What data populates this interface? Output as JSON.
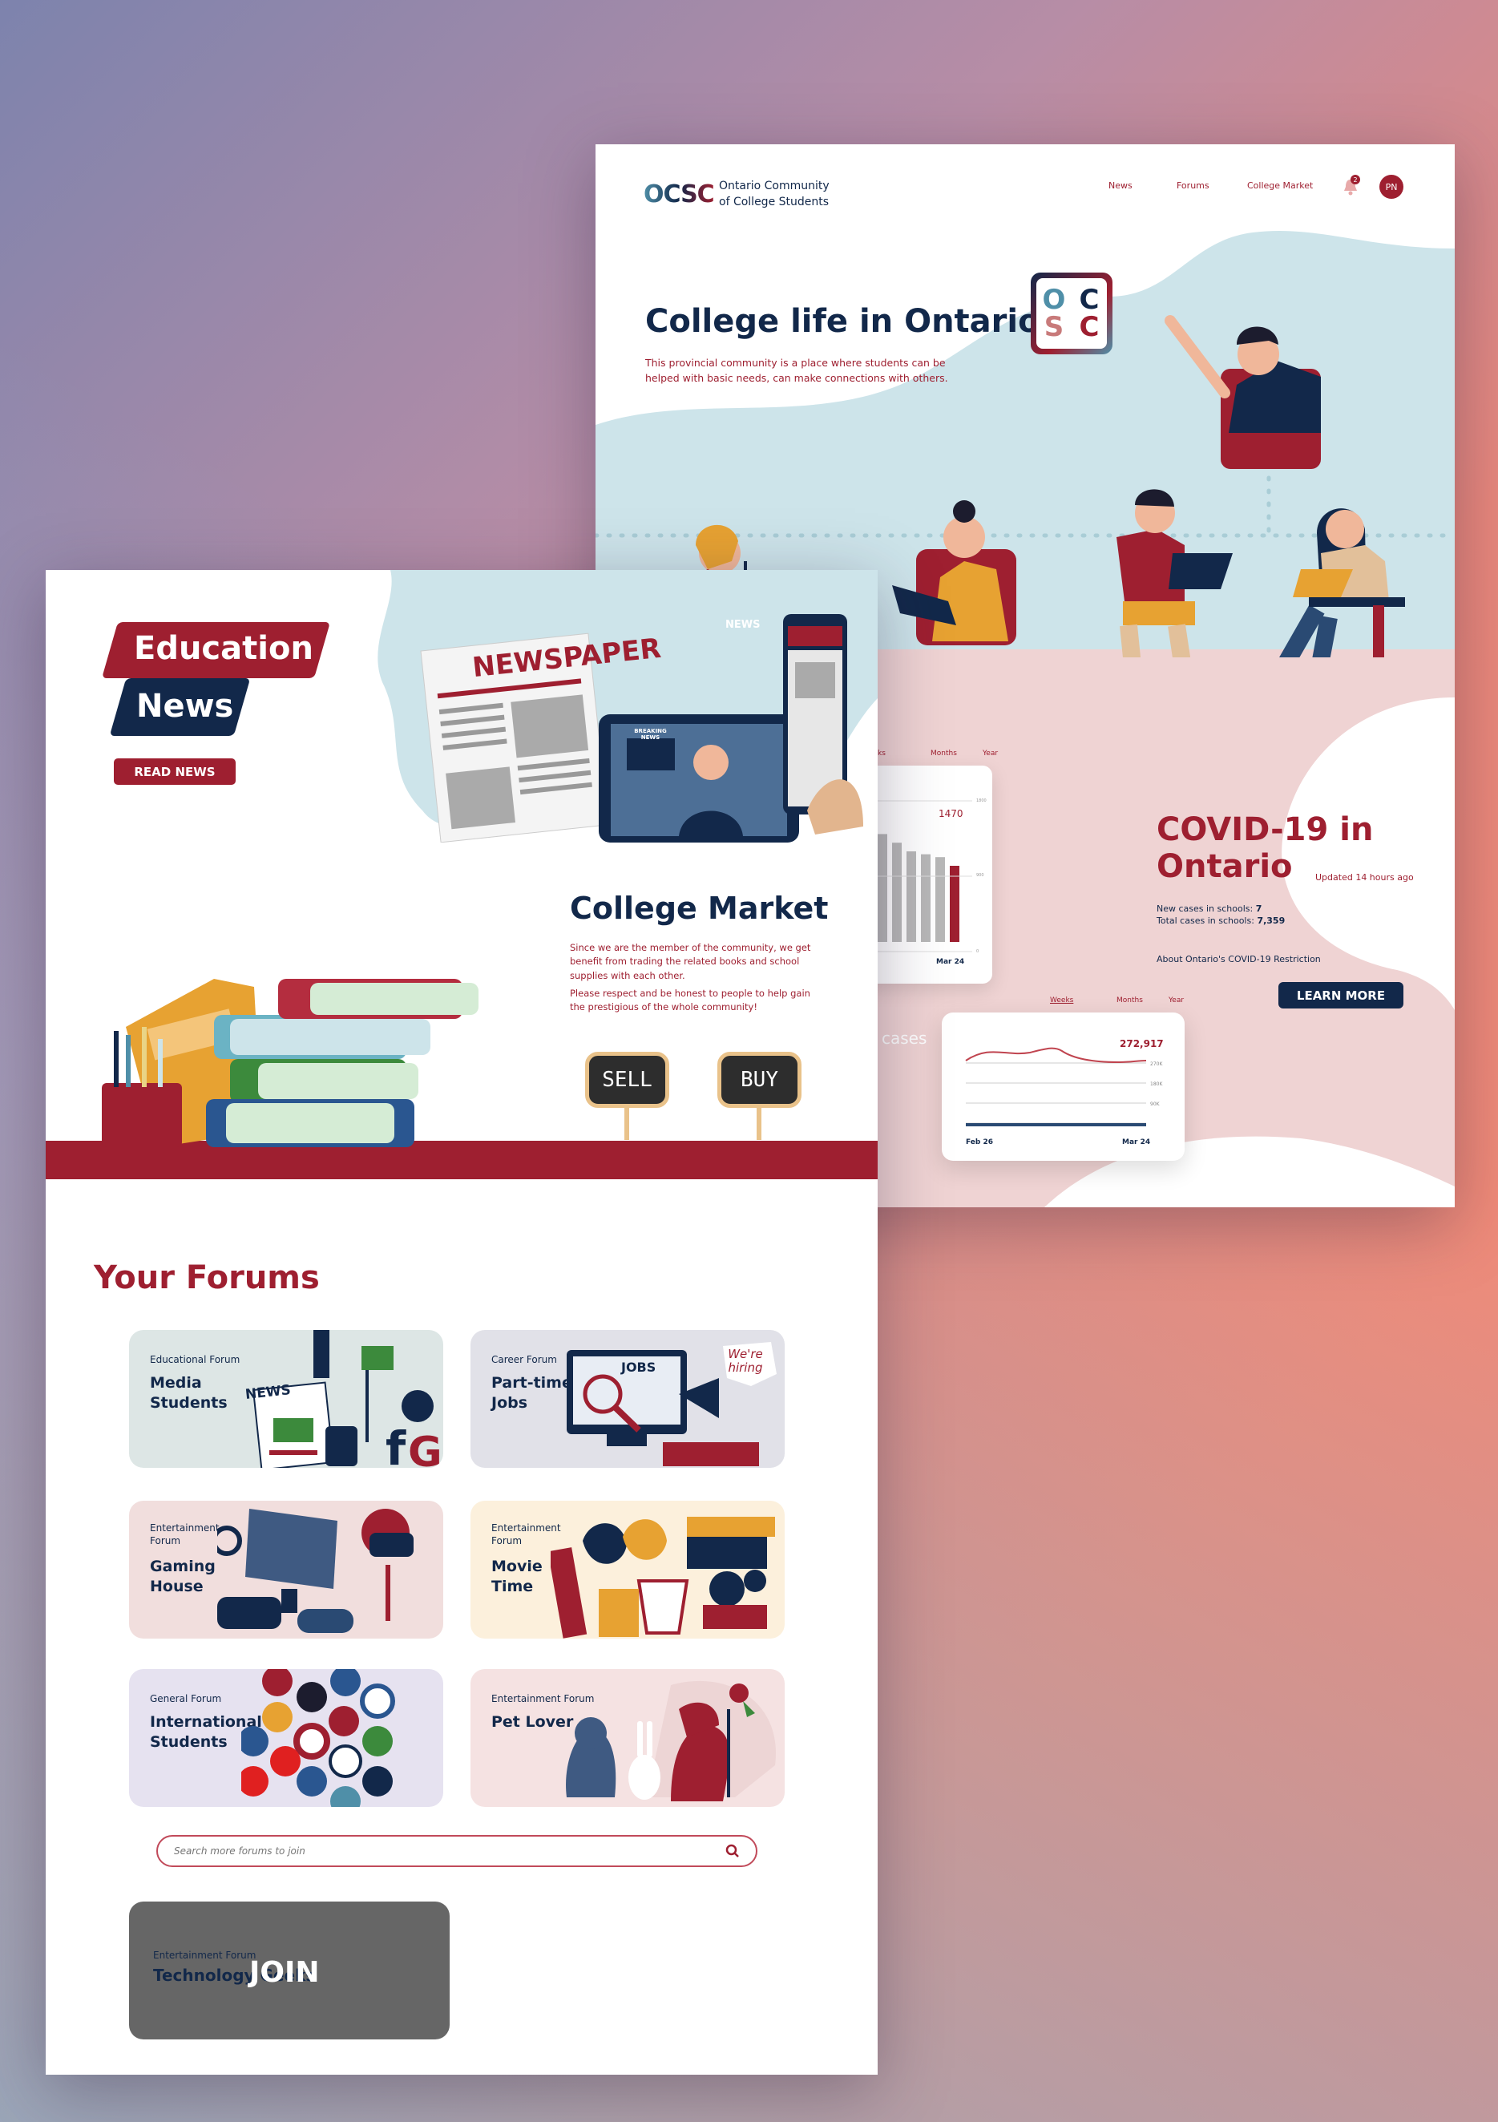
{
  "site": {
    "logo_text": "OCSC",
    "name_line1": "Ontario Community",
    "name_line2": "of College Students"
  },
  "nav": {
    "items": [
      "News",
      "Forums",
      "College Market"
    ],
    "notification_count": "2",
    "avatar_initials": "PN"
  },
  "hero": {
    "title": "College life in Ontario",
    "subtitle": "This provincial community is a place where students can be helped with basic needs, can make connections with others."
  },
  "covid": {
    "title_line1": "COVID-19 in",
    "title_line2": "Ontario",
    "updated": "Updated 14 hours ago",
    "new_cases_label": "New cases in schools: ",
    "new_cases_value": "7",
    "total_cases_label": "Total cases in schools: ",
    "total_cases_value": "7,359",
    "restriction_link": "About Ontario's COVID-19 Restriction",
    "learn_more": "LEARN MORE",
    "cases_word": "cases",
    "tabs_top": [
      "ks",
      "Months",
      "Year"
    ],
    "tabs_bottom": [
      "Weeks",
      "Months",
      "Year"
    ],
    "bar_label": "1470",
    "bar_axis": [
      "1800",
      "900",
      "0"
    ],
    "bar_date": "Mar 24",
    "line_label": "272,917",
    "line_axis": [
      "270K",
      "180K",
      "90K"
    ],
    "line_date_start": "Feb 26",
    "line_date_end": "Mar 24"
  },
  "education": {
    "title_line1": "Education",
    "title_line2": "News",
    "read_news": "READ NEWS",
    "newspaper": "NEWSPAPER",
    "phone_news": "NEWS",
    "breaking": "BREAKING NEWS"
  },
  "market": {
    "title": "College Market",
    "para1": "Since we are the member of the community, we get benefit from trading the related books and school supplies with each other.",
    "para2": "Please respect and be honest to people to help gain the prestigious of the whole community!",
    "sell": "SELL",
    "buy": "BUY"
  },
  "forums": {
    "title": "Your Forums",
    "items": [
      {
        "category": "Educational Forum",
        "name": "Media\nStudents"
      },
      {
        "category": "Career Forum",
        "name": "Part-time\nJobs"
      },
      {
        "category": "Entertainment\nForum",
        "name": "Gaming\nHouse"
      },
      {
        "category": "Entertainment\nForum",
        "name": "Movie\nTime"
      },
      {
        "category": "General Forum",
        "name": "International\nStudents"
      },
      {
        "category": "Entertainment Forum",
        "name": "Pet Lover"
      }
    ],
    "jobs_label": "JOBS",
    "hiring_label": "We're hiring",
    "news_label": "NEWS",
    "search_placeholder": "Search more forums to join",
    "join_card_category": "Entertainment Forum",
    "join_card_name": "Technology Geeks",
    "join_label": "JOIN"
  },
  "colors": {
    "navy": "#12284a",
    "crimson": "#9e1f30",
    "light_blue": "#cde4ea",
    "pink": "#f1d4d4"
  }
}
